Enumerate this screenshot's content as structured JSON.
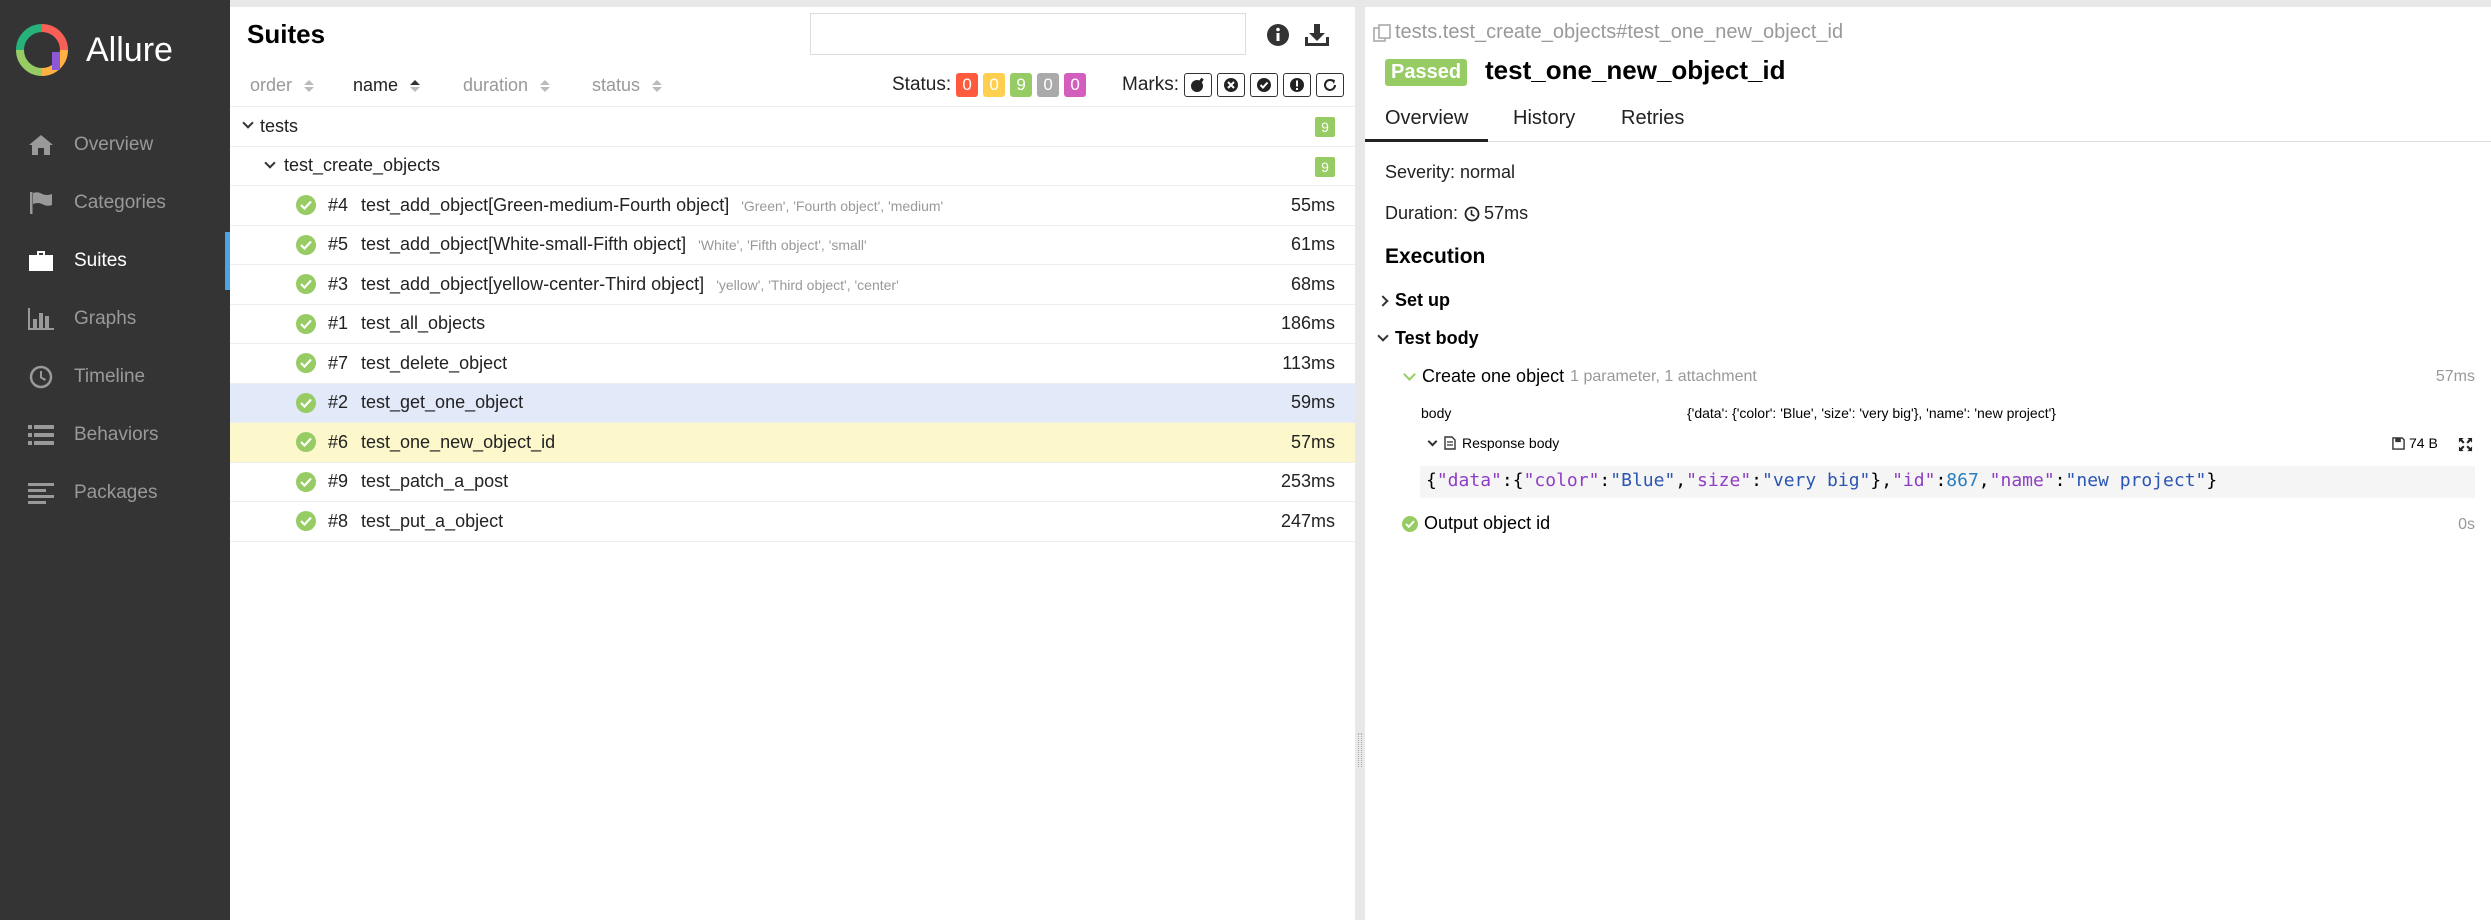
{
  "app": {
    "name": "Allure"
  },
  "sidebar": {
    "items": [
      {
        "label": "Overview",
        "icon": "home-icon"
      },
      {
        "label": "Categories",
        "icon": "flag-icon"
      },
      {
        "label": "Suites",
        "icon": "briefcase-icon",
        "active": true
      },
      {
        "label": "Graphs",
        "icon": "bar-chart-icon"
      },
      {
        "label": "Timeline",
        "icon": "clock-icon"
      },
      {
        "label": "Behaviors",
        "icon": "list-icon"
      },
      {
        "label": "Packages",
        "icon": "align-left-icon"
      }
    ]
  },
  "suites": {
    "title": "Suites",
    "search": {
      "value": "",
      "placeholder": ""
    },
    "sort": {
      "order": "order",
      "name": "name",
      "duration": "duration",
      "status": "status"
    },
    "status_label": "Status:",
    "status_counts": [
      {
        "value": "0",
        "color": "#fd5a3e"
      },
      {
        "value": "0",
        "color": "#ffd050"
      },
      {
        "value": "9",
        "color": "#97cc64"
      },
      {
        "value": "0",
        "color": "#aaaaaa"
      },
      {
        "value": "0",
        "color": "#d35ebe"
      }
    ],
    "marks_label": "Marks:",
    "tree": {
      "root": {
        "name": "tests",
        "count": "9"
      },
      "group": {
        "name": "test_create_objects",
        "count": "9"
      }
    },
    "tests": [
      {
        "num": "#4",
        "name": "test_add_object[Green-medium-Fourth object]",
        "params": "'Green', 'Fourth object', 'medium'",
        "duration": "55ms"
      },
      {
        "num": "#5",
        "name": "test_add_object[White-small-Fifth object]",
        "params": "'White', 'Fifth object', 'small'",
        "duration": "61ms"
      },
      {
        "num": "#3",
        "name": "test_add_object[yellow-center-Third object]",
        "params": "'yellow', 'Third object', 'center'",
        "duration": "68ms"
      },
      {
        "num": "#1",
        "name": "test_all_objects",
        "params": "",
        "duration": "186ms"
      },
      {
        "num": "#7",
        "name": "test_delete_object",
        "params": "",
        "duration": "113ms"
      },
      {
        "num": "#2",
        "name": "test_get_one_object",
        "params": "",
        "duration": "59ms"
      },
      {
        "num": "#6",
        "name": "test_one_new_object_id",
        "params": "",
        "duration": "57ms"
      },
      {
        "num": "#9",
        "name": "test_patch_a_post",
        "params": "",
        "duration": "253ms"
      },
      {
        "num": "#8",
        "name": "test_put_a_object",
        "params": "",
        "duration": "247ms"
      }
    ]
  },
  "detail": {
    "path": "tests.test_create_objects#test_one_new_object_id",
    "status": "Passed",
    "title": "test_one_new_object_id",
    "tabs": [
      "Overview",
      "History",
      "Retries"
    ],
    "severity": "Severity: normal",
    "duration_label": "Duration:",
    "duration": "57ms",
    "execution": "Execution",
    "setup": "Set up",
    "test_body": "Test body",
    "step1": {
      "name": "Create one object",
      "meta": "1 parameter, 1 attachment",
      "duration": "57ms"
    },
    "param": {
      "name": "body",
      "value": "{'data': {'color': 'Blue', 'size': 'very big'}, 'name': 'new project'}"
    },
    "attachment": {
      "name": "Response body",
      "size": "74 B"
    },
    "code": {
      "p1": "{",
      "k_data": "\"data\"",
      "p2": ":{",
      "k_color": "\"color\"",
      "colon1": ":",
      "v_color": "\"Blue\"",
      "comma1": ",",
      "k_size": "\"size\"",
      "colon2": ":",
      "v_size": "\"very big\"",
      "p3": "},",
      "k_id": "\"id\"",
      "colon3": ":",
      "v_id": "867",
      "comma2": ",",
      "k_name": "\"name\"",
      "colon4": ":",
      "v_name": "\"new project\"",
      "p4": "}"
    },
    "step2": {
      "name": "Output object id",
      "duration": "0s"
    }
  }
}
